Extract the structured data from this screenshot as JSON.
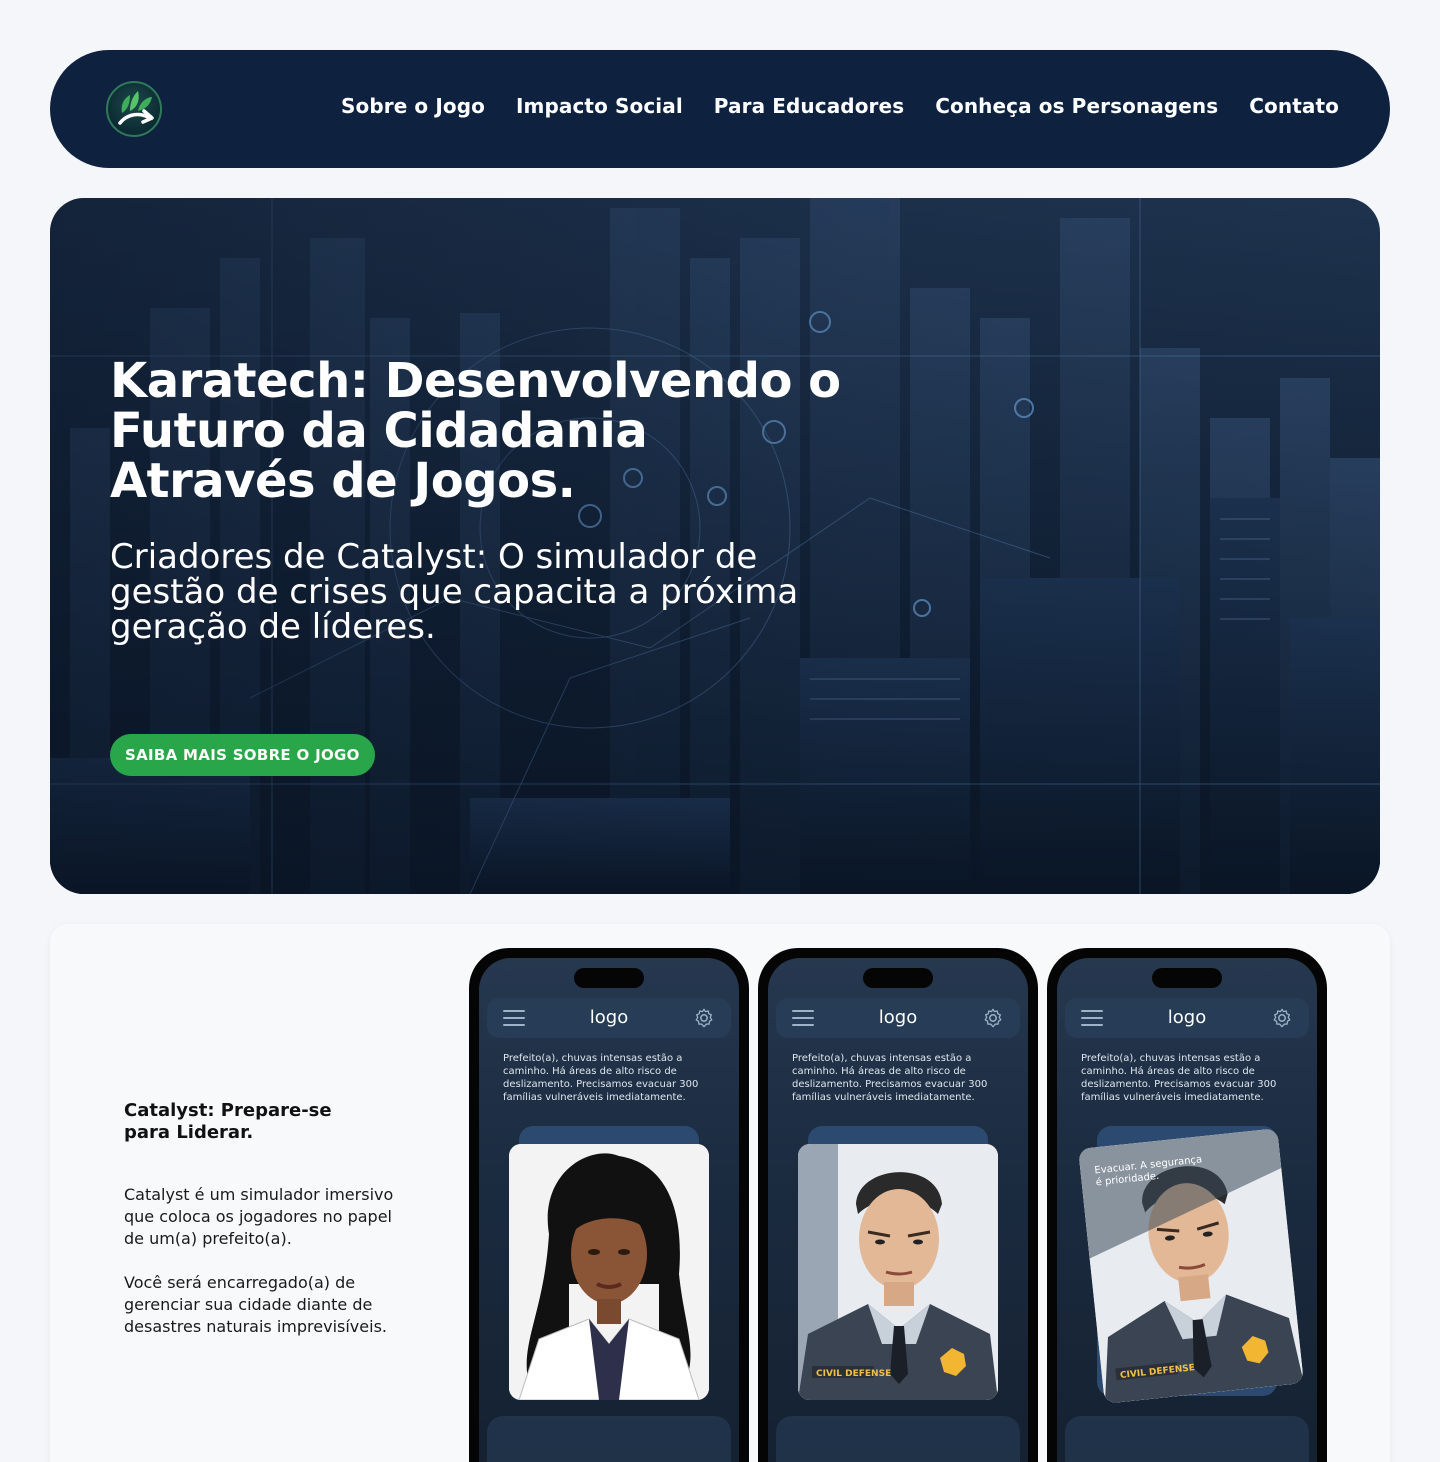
{
  "nav": {
    "logo_icon": "karatech-leaf-arrow-logo",
    "links": [
      "Sobre o Jogo",
      "Impacto Social",
      "Para Educadores",
      "Conheça os Personagens",
      "Contato"
    ]
  },
  "hero": {
    "title": "Karatech: Desenvolvendo o Futuro da Cidadania Através de Jogos.",
    "subtitle": "Criadores de Catalyst: O simulador de gestão de crises que capacita a próxima geração de líderes.",
    "cta_label": "SAIBA MAIS SOBRE O JOGO"
  },
  "catalyst": {
    "title": "Catalyst: Prepare-se para Liderar.",
    "paragraph_1": "Catalyst é um simulador imersivo que coloca os jogadores no papel de um(a) prefeito(a).",
    "paragraph_2": "Você será encarregado(a) de gerenciar sua cidade diante de desastres naturais imprevisíveis."
  },
  "phones": [
    {
      "logo": "logo",
      "message": "Prefeito(a), chuvas intensas estão a caminho. Há áreas de alto risco de deslizamento. Precisamos evacuar 300 famílias vulneráveis imediatamente.",
      "card_character": "woman-advisor",
      "card_text": ""
    },
    {
      "logo": "logo",
      "message": "Prefeito(a), chuvas intensas estão a caminho. Há áreas de alto risco de deslizamento. Precisamos evacuar 300 famílias vulneráveis imediatamente.",
      "card_character": "civil-defense-officer",
      "badge_label": "CIVIL DEFENSE",
      "card_text": ""
    },
    {
      "logo": "logo",
      "message": "Prefeito(a), chuvas intensas estão a caminho. Há áreas de alto risco de deslizamento. Precisamos evacuar 300 famílias vulneráveis imediatamente.",
      "card_character": "civil-defense-officer",
      "badge_label": "CIVIL DEFENSE",
      "card_text": "Evacuar. A segurança é prioridade."
    }
  ],
  "colors": {
    "nav_bg": "#0e223f",
    "cta_green": "#2aa64a",
    "page_bg": "#f4f6f9"
  }
}
